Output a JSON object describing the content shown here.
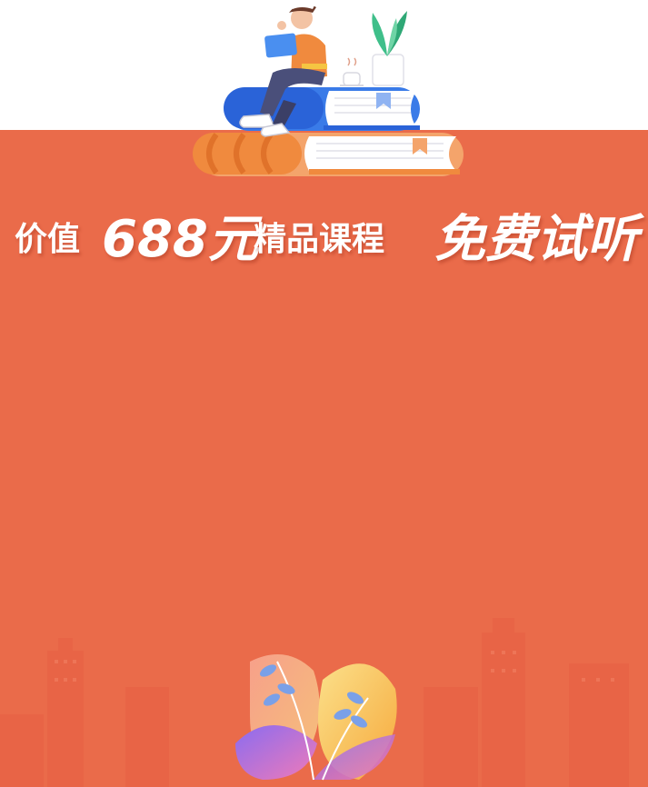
{
  "headline": {
    "prefix": "价值",
    "amount": "688元",
    "course": "精品课程",
    "cta": "免费试听"
  },
  "colors": {
    "background_main": "#ea6b4a",
    "background_top": "#ffffff",
    "book_blue": "#2a63d8",
    "book_orange": "#f08a3e",
    "plant_green": "#3fbf8a"
  },
  "illustration": {
    "hero": "person-reading-on-books-illustration",
    "footer": "decorative-leaves-illustration",
    "background": "city-skyline-silhouette"
  }
}
